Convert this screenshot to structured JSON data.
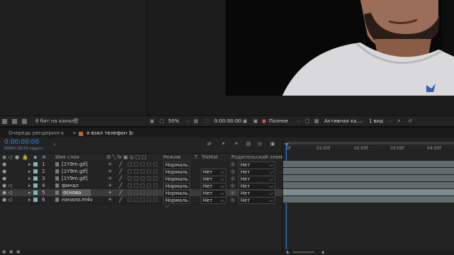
{
  "project_panel": {
    "bit_depth": "8 бит на канал"
  },
  "viewer_toolbar": {
    "zoom": "50%",
    "timecode": "0:00:00:00",
    "resolution": "Полное",
    "camera": "Активная ка...",
    "view_layout": "1 вид"
  },
  "tabs": {
    "render_queue": "Очередь рендеринга",
    "composition": "я взял телефон 1"
  },
  "timeline": {
    "current_time": "0:00:00:00",
    "frame_info": "00000 (30.00 кадр/с)",
    "search_placeholder": "",
    "columns": {
      "layer_name": "Имя слоя",
      "mode": "Режим",
      "t": "T",
      "trkmat": "TrkMat",
      "parent": "Родительский элемент"
    },
    "layers": [
      {
        "num": "1",
        "name": "[1Y9m.gif]",
        "mode": "Нормаль",
        "trkmat": "",
        "parent": "Нет",
        "color": "#7fb7b3"
      },
      {
        "num": "2",
        "name": "[1Y9m.gif]",
        "mode": "Нормаль",
        "trkmat": "Нет",
        "parent": "Нет",
        "color": "#7fb7b3"
      },
      {
        "num": "3",
        "name": "[1Y9m.gif]",
        "mode": "Нормаль",
        "trkmat": "Нет",
        "parent": "Нет",
        "color": "#7fb7b3"
      },
      {
        "num": "4",
        "name": "финал",
        "mode": "Нормаль",
        "trkmat": "Нет",
        "parent": "Нет",
        "color": "#7fb7b3"
      },
      {
        "num": "5",
        "name": "основа",
        "mode": "Нормаль",
        "trkmat": "Нет",
        "parent": "Нет",
        "color": "#7fb7b3"
      },
      {
        "num": "6",
        "name": "начало.m4v",
        "mode": "Нормаль",
        "trkmat": "Нет",
        "parent": "Нет",
        "color": "#7fb7b3"
      }
    ],
    "ruler": [
      "0f",
      "01:00f",
      "02:00f",
      "03:00f",
      "04:00f"
    ]
  },
  "colors": {
    "accent": "#2d8ceb",
    "label_teal": "#7fb7b3",
    "layer_bar": "#5f6b6e"
  }
}
